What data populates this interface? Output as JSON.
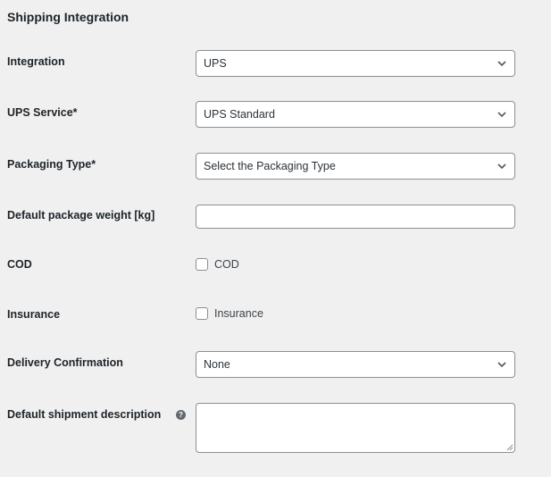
{
  "section": {
    "title": "Shipping Integration"
  },
  "fields": {
    "integration": {
      "label": "Integration",
      "value": "UPS"
    },
    "ups_service": {
      "label": "UPS Service*",
      "value": "UPS Standard"
    },
    "packaging_type": {
      "label": "Packaging Type*",
      "value": "Select the Packaging Type"
    },
    "package_weight": {
      "label": "Default package weight [kg]",
      "value": ""
    },
    "cod": {
      "label": "COD",
      "checkbox_label": "COD",
      "checked": false
    },
    "insurance": {
      "label": "Insurance",
      "checkbox_label": "Insurance",
      "checked": false
    },
    "delivery_confirmation": {
      "label": "Delivery Confirmation",
      "value": "None"
    },
    "shipment_description": {
      "label": "Default shipment description",
      "value": "",
      "help_icon": "question-mark"
    }
  }
}
